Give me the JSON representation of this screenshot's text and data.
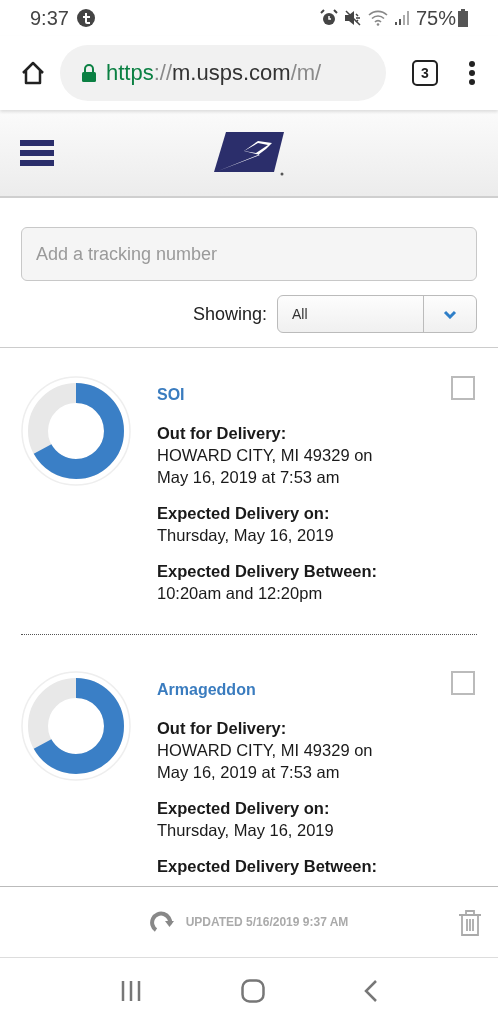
{
  "status_bar": {
    "time": "9:37",
    "battery": "75%"
  },
  "browser": {
    "url_parts": [
      {
        "text": "https",
        "kind": "scheme"
      },
      {
        "text": "://",
        "kind": "muted"
      },
      {
        "text": "m.usps.com",
        "kind": "host"
      },
      {
        "text": "/m/",
        "kind": "muted"
      }
    ],
    "tab_count": "3"
  },
  "search": {
    "placeholder": "Add a tracking number"
  },
  "filter": {
    "label": "Showing:",
    "value": "All"
  },
  "packages": [
    {
      "name": "SOI",
      "level": 0.67,
      "checked": false,
      "details": [
        {
          "label": "Out for Delivery:",
          "value": "HOWARD CITY, MI 49329 on May 16, 2019 at 7:53 am"
        },
        {
          "label": "Expected Delivery on:",
          "value": "Thursday, May 16, 2019"
        },
        {
          "label": "Expected Delivery Between:",
          "value": "10:20am and 12:20pm"
        }
      ]
    },
    {
      "name": "Armageddon",
      "level": 0.67,
      "checked": false,
      "details": [
        {
          "label": "Out for Delivery:",
          "value": "HOWARD CITY, MI 49329 on May 16, 2019 at 7:53 am"
        },
        {
          "label": "Expected Delivery on:",
          "value": "Thursday, May 16, 2019"
        },
        {
          "label": "Expected Delivery Between:"
        }
      ]
    }
  ],
  "footer": {
    "updated": "UPDATED 5/16/2019 9:37 AM"
  }
}
